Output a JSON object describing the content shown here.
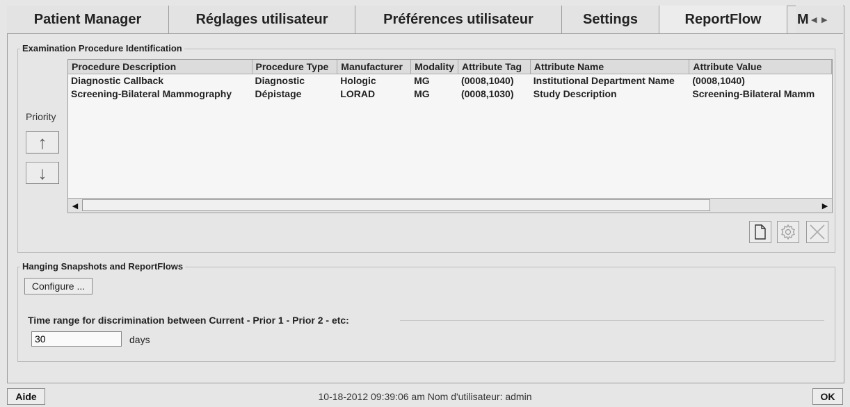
{
  "tabs": [
    {
      "label": "Patient Manager",
      "active": false
    },
    {
      "label": "Réglages utilisateur",
      "active": false
    },
    {
      "label": "Préférences utilisateur",
      "active": false
    },
    {
      "label": "Settings",
      "active": false
    },
    {
      "label": "ReportFlow",
      "active": true
    }
  ],
  "tab_overflow_label": "M",
  "exam_group": {
    "legend": "Examination Procedure Identification",
    "priority_label": "Priority",
    "columns": [
      "Procedure Description",
      "Procedure Type",
      "Manufacturer",
      "Modality",
      "Attribute Tag",
      "Attribute Name",
      "Attribute Value"
    ],
    "rows": [
      [
        "Diagnostic Callback",
        "Diagnostic",
        "Hologic",
        "MG",
        "(0008,1040)",
        "Institutional Department Name",
        "(0008,1040)"
      ],
      [
        "Screening-Bilateral Mammography",
        "Dépistage",
        "LORAD",
        "MG",
        "(0008,1030)",
        "Study Description",
        "Screening-Bilateral Mamm"
      ]
    ]
  },
  "hanging_group": {
    "legend": "Hanging Snapshots and ReportFlows",
    "configure_label": "Configure ...",
    "time_range_label": "Time range for discrimination between Current - Prior 1 - Prior 2 - etc:",
    "days_value": "30",
    "days_unit": "days"
  },
  "status": {
    "help_label": "Aide",
    "text": "10-18-2012  09:39:06 am  Nom d'utilisateur:  admin",
    "ok_label": "OK"
  }
}
